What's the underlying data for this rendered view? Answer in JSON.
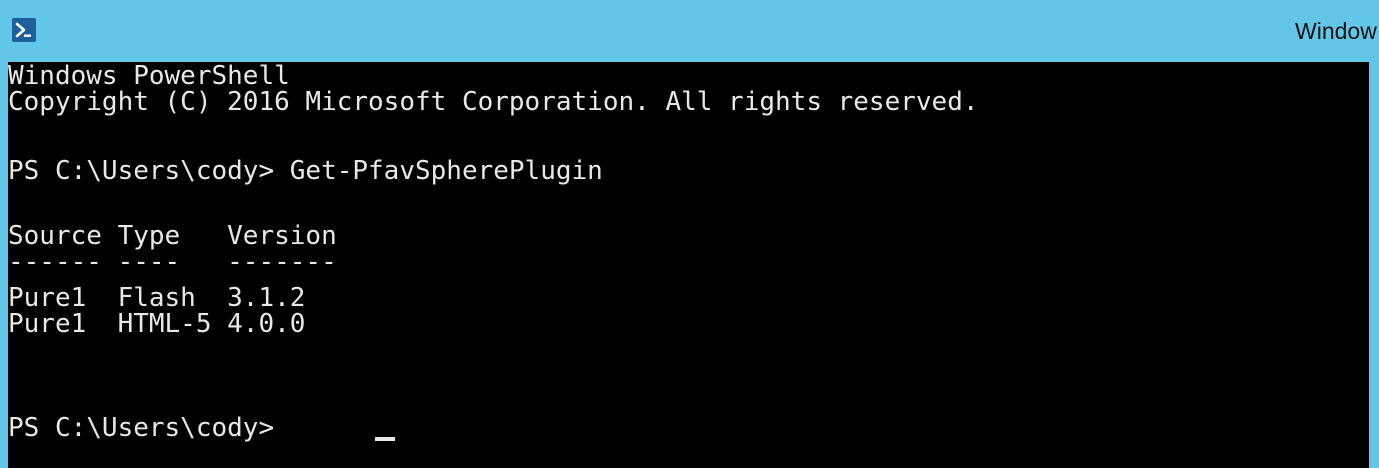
{
  "window": {
    "title": "Window",
    "icon": "powershell-icon"
  },
  "console": {
    "background": "#000000",
    "foreground": "#e8e8e8",
    "lines": [
      "Windows PowerShell",
      "Copyright (C) 2016 Microsoft Corporation. All rights reserved.",
      "PS C:\\Users\\cody> Get-PfavSpherePlugin",
      "Source Type   Version",
      "------ ----   -------",
      "Pure1  Flash  3.1.2",
      "Pure1  HTML-5 4.0.0",
      "PS C:\\Users\\cody> "
    ]
  },
  "colors": {
    "titlebar": "#62c6e8",
    "console_bg": "#000000",
    "text": "#e8e8e8"
  }
}
